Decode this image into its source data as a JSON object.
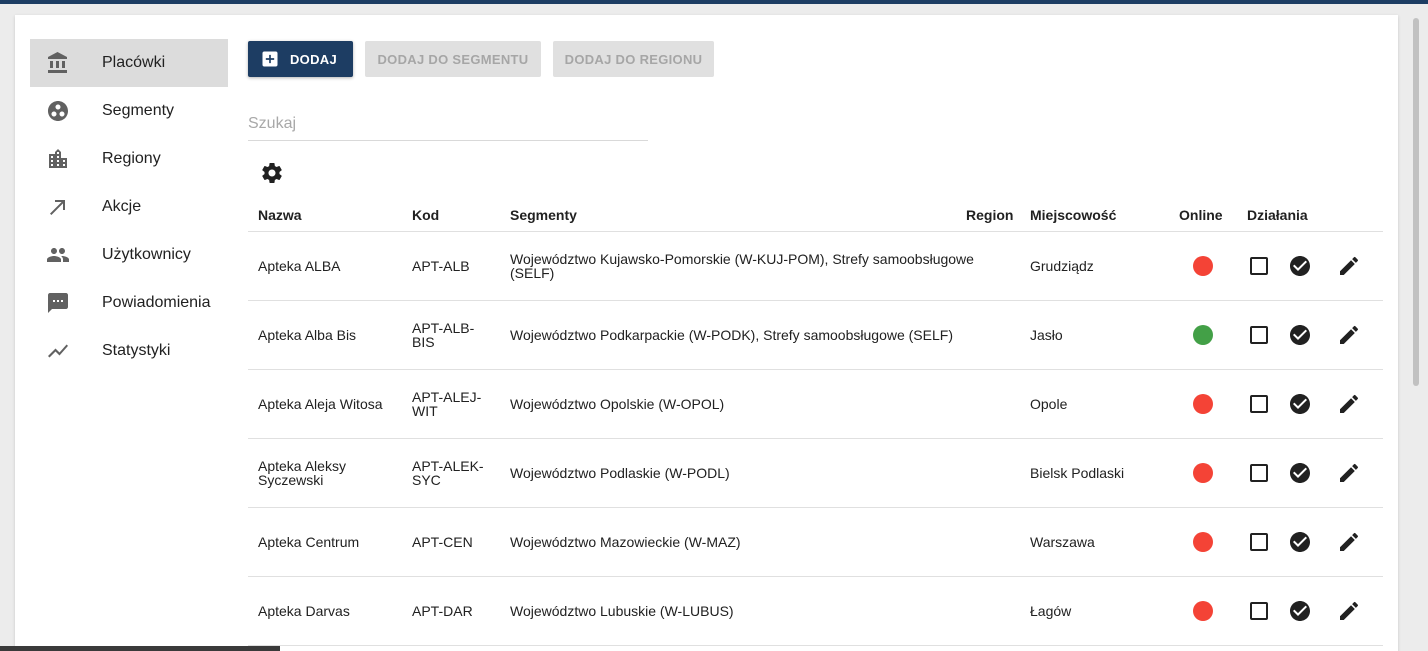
{
  "sidebar": {
    "items": [
      {
        "label": "Placówki",
        "icon": "bank-icon",
        "active": true
      },
      {
        "label": "Segmenty",
        "icon": "segments-icon",
        "active": false
      },
      {
        "label": "Regiony",
        "icon": "city-icon",
        "active": false
      },
      {
        "label": "Akcje",
        "icon": "arrow-up-right-icon",
        "active": false
      },
      {
        "label": "Użytkownicy",
        "icon": "people-icon",
        "active": false
      },
      {
        "label": "Powiadomienia",
        "icon": "message-icon",
        "active": false
      },
      {
        "label": "Statystyki",
        "icon": "trending-icon",
        "active": false
      }
    ]
  },
  "toolbar": {
    "add_label": "DODAJ",
    "add_to_segment_label": "DODAJ DO SEGMENTU",
    "add_to_region_label": "DODAJ DO REGIONU"
  },
  "search": {
    "placeholder": "Szukaj",
    "value": ""
  },
  "table": {
    "columns": {
      "name": "Nazwa",
      "code": "Kod",
      "segments": "Segmenty",
      "region": "Region",
      "city": "Miejscowość",
      "online": "Online",
      "actions": "Działania"
    },
    "rows": [
      {
        "name": "Apteka ALBA",
        "code": "APT-ALB",
        "segments": "Województwo Kujawsko-Pomorskie (W-KUJ-POM), Strefy samoobsługowe (SELF)",
        "region": "",
        "city": "Grudziądz",
        "online": false
      },
      {
        "name": "Apteka Alba Bis",
        "code": "APT-ALB-BIS",
        "segments": "Województwo Podkarpackie (W-PODK), Strefy samoobsługowe (SELF)",
        "region": "",
        "city": "Jasło",
        "online": true
      },
      {
        "name": "Apteka Aleja Witosa",
        "code": "APT-ALEJ-WIT",
        "segments": "Województwo Opolskie (W-OPOL)",
        "region": "",
        "city": "Opole",
        "online": false
      },
      {
        "name": "Apteka Aleksy Syczewski",
        "code": "APT-ALEK-SYC",
        "segments": "Województwo Podlaskie (W-PODL)",
        "region": "",
        "city": "Bielsk Podlaski",
        "online": false
      },
      {
        "name": "Apteka Centrum",
        "code": "APT-CEN",
        "segments": "Województwo Mazowieckie (W-MAZ)",
        "region": "",
        "city": "Warszawa",
        "online": false
      },
      {
        "name": "Apteka Darvas",
        "code": "APT-DAR",
        "segments": "Województwo Lubuskie (W-LUBUS)",
        "region": "",
        "city": "Łagów",
        "online": false
      }
    ]
  },
  "colors": {
    "primary": "#1d3d63",
    "online": "#43a047",
    "offline": "#f44336",
    "disabled_bg": "#e0e0e0",
    "disabled_text": "#a6a6a6"
  }
}
